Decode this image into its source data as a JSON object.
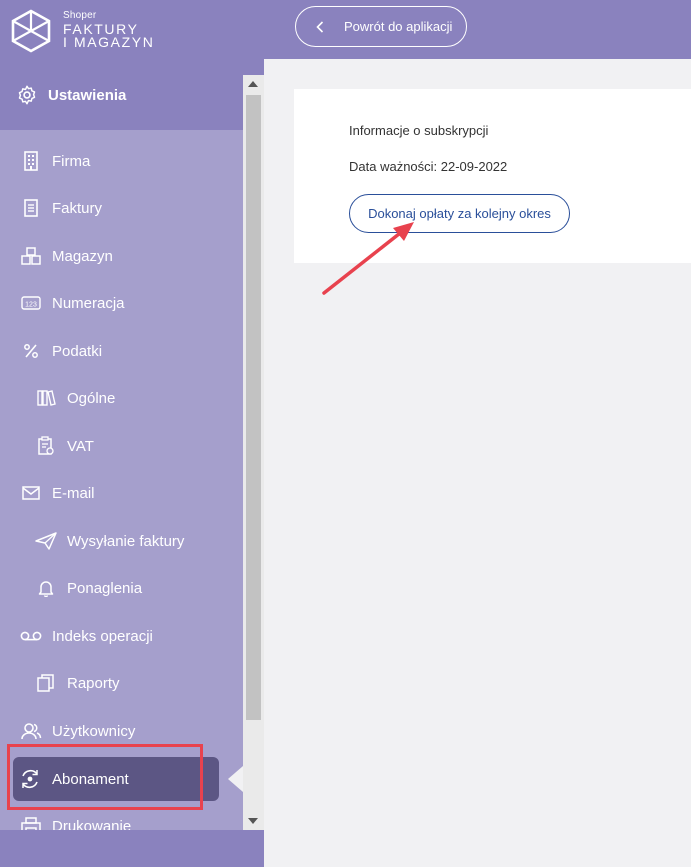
{
  "brand": {
    "small": "Shoper",
    "line1": "FAKTURY",
    "line2": "I MAGAZYN",
    "icon": "hexagon-logo-icon"
  },
  "settings": {
    "label": "Ustawienia",
    "icon": "gear-icon"
  },
  "menu": [
    {
      "label": "Firma",
      "icon": "building-icon"
    },
    {
      "label": "Faktury",
      "icon": "invoice-icon"
    },
    {
      "label": "Magazyn",
      "icon": "boxes-icon"
    },
    {
      "label": "Numeracja",
      "icon": "numbering-icon"
    },
    {
      "label": "Podatki",
      "icon": "percent-icon"
    },
    {
      "label": "Ogólne",
      "icon": "books-icon"
    },
    {
      "label": "VAT",
      "icon": "clipboard-icon"
    },
    {
      "label": "E-mail",
      "icon": "envelope-icon"
    },
    {
      "label": "Wysyłanie faktury",
      "icon": "paper-plane-icon"
    },
    {
      "label": "Ponaglenia",
      "icon": "bell-icon"
    },
    {
      "label": "Indeks operacji",
      "icon": "voicemail-icon"
    },
    {
      "label": "Raporty",
      "icon": "copy-icon"
    },
    {
      "label": "Użytkownicy",
      "icon": "users-icon"
    },
    {
      "label": "Abonament",
      "icon": "sync-circle-icon",
      "active": true
    },
    {
      "label": "Drukowanie",
      "icon": "printer-icon"
    }
  ],
  "topbar": {
    "back_label": "Powrót do aplikacji",
    "back_icon": "chevron-left-icon"
  },
  "subscription": {
    "title": "Informacje o subskrypcji",
    "expiry": "Data ważności: 22-09-2022",
    "pay_label": "Dokonaj opłaty za kolejny okres"
  },
  "colors": {
    "sidebar_dark": "#8a82be",
    "sidebar_light": "#a59fcc",
    "active": "#5c5684",
    "annotation": "#e8424e",
    "link": "#2a4f9a"
  }
}
